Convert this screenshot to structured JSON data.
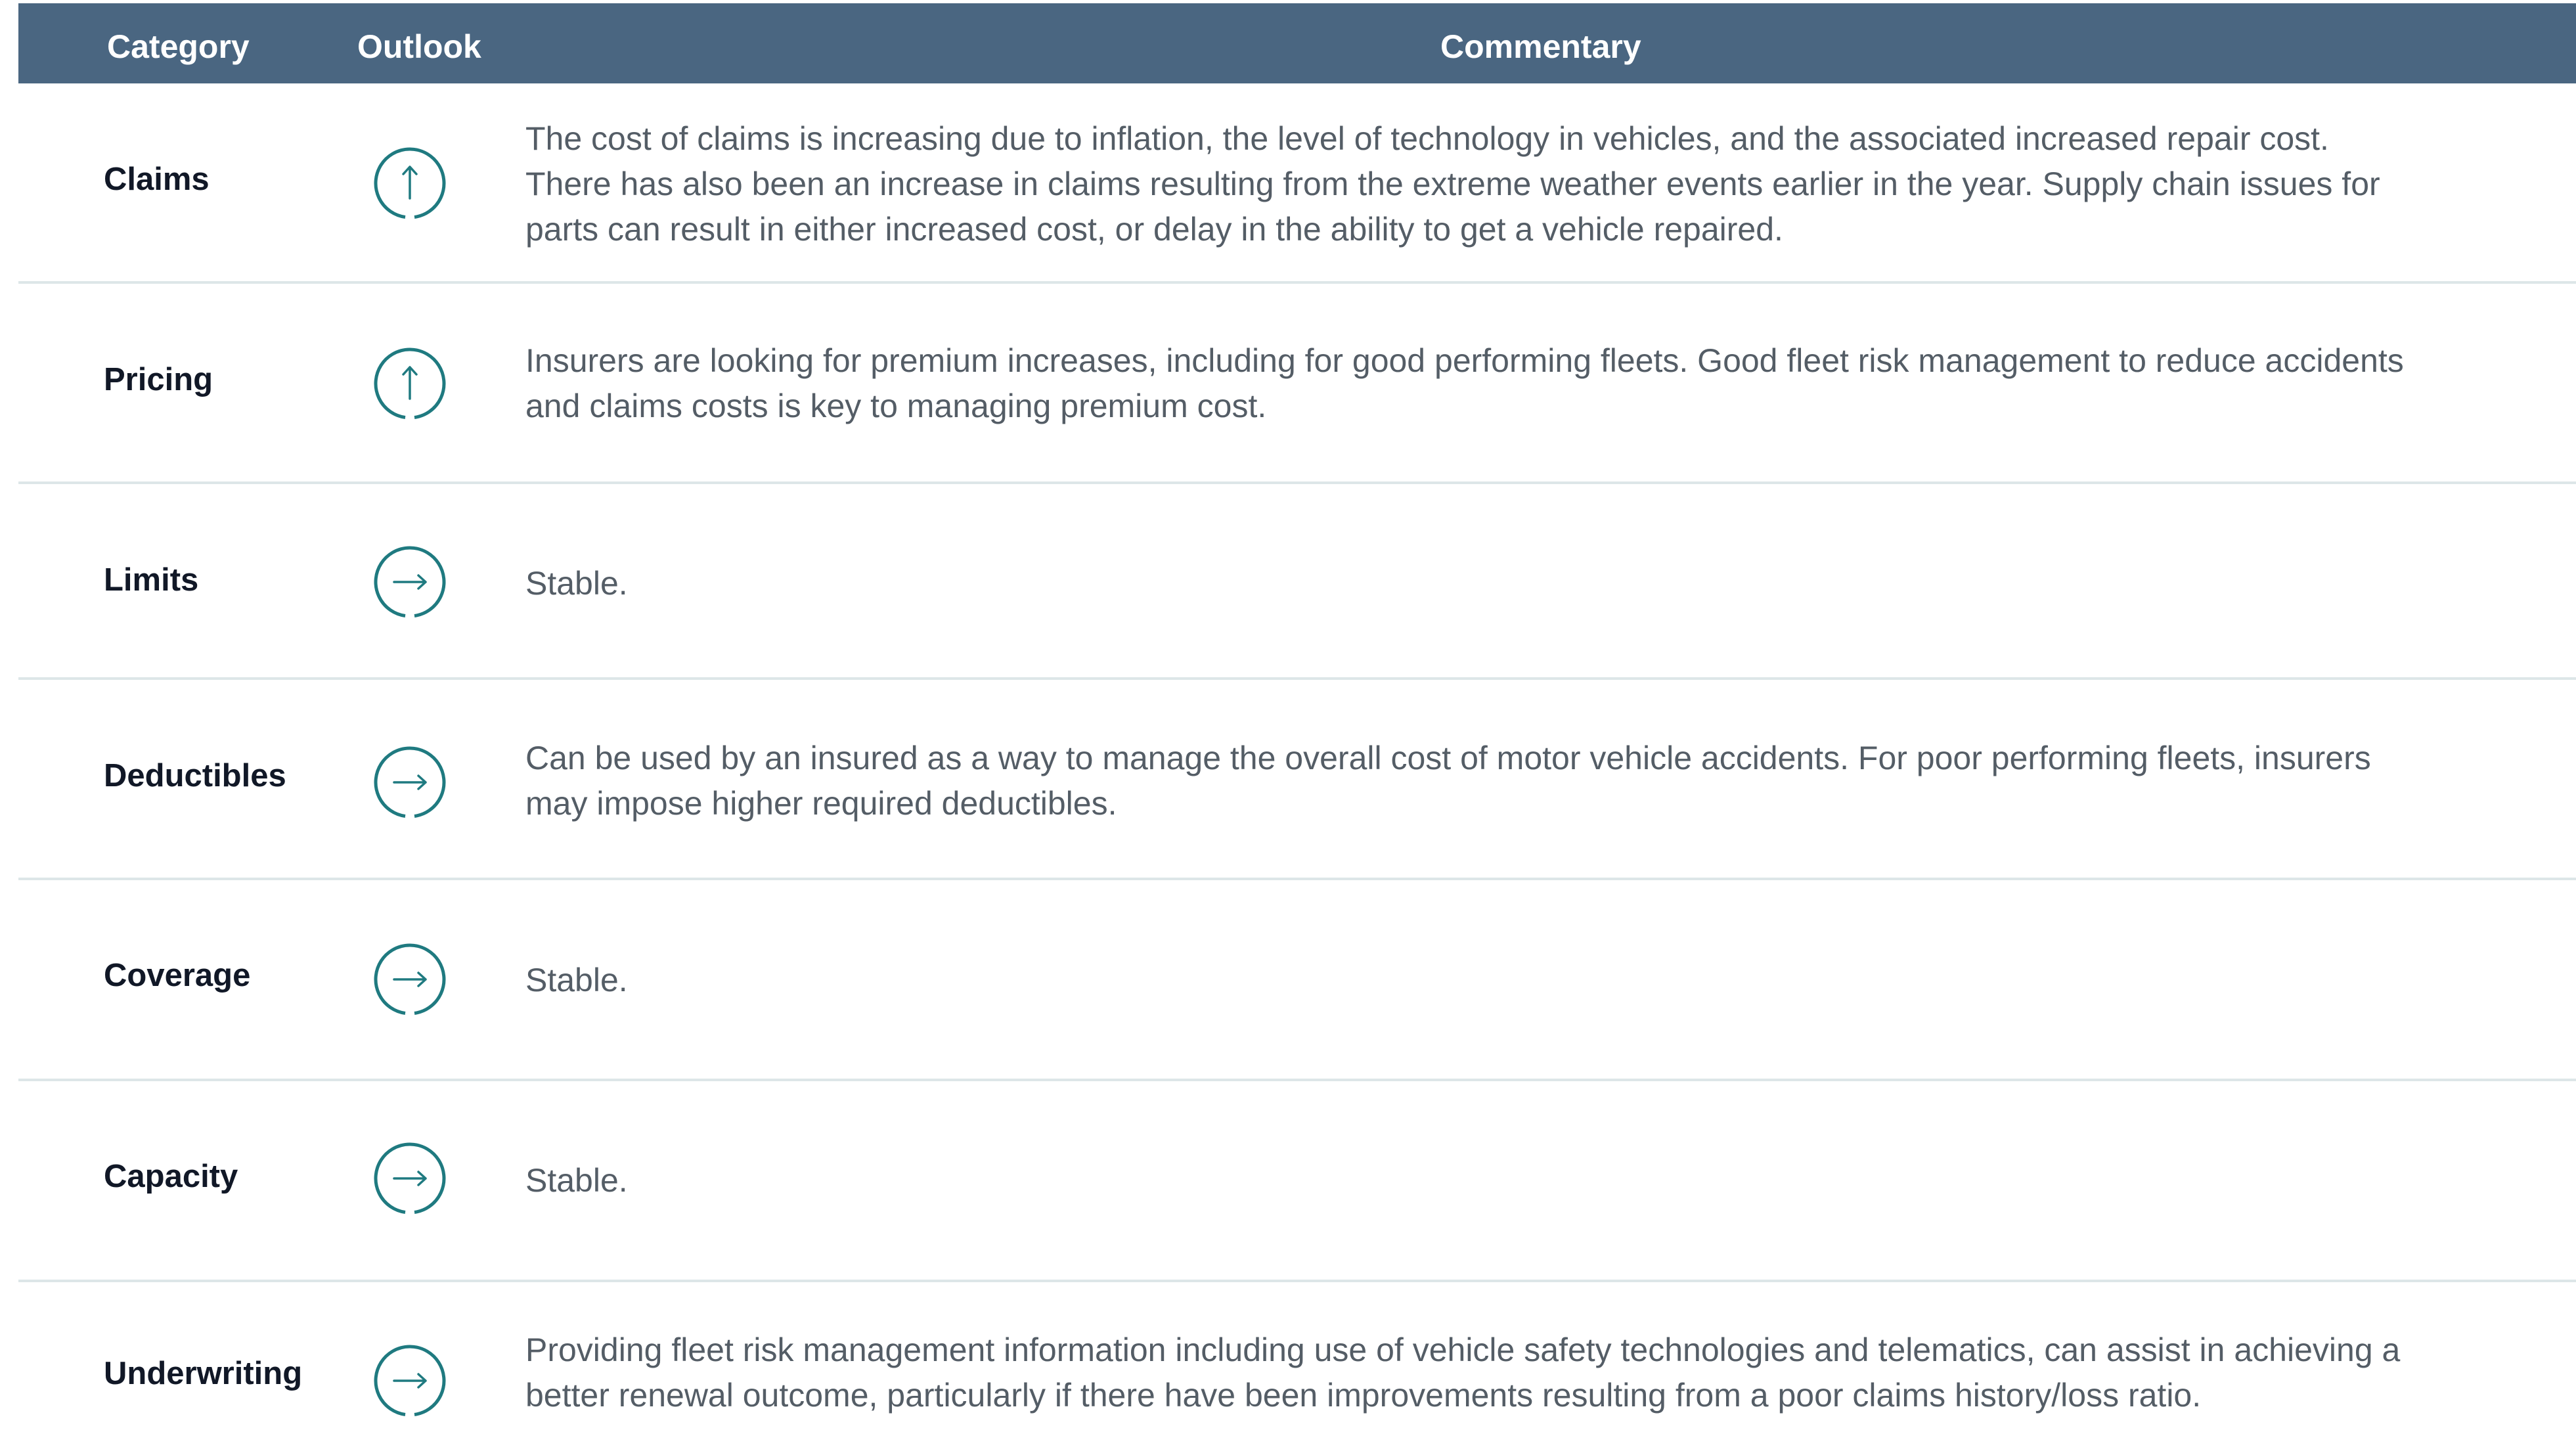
{
  "header": {
    "category_label": "Category",
    "outlook_label": "Outlook",
    "commentary_label": "Commentary"
  },
  "colors": {
    "header_bg": "#4a6681",
    "accent": "#1f7a80",
    "divider": "#dde6e8",
    "body_text": "#545d66",
    "category_text": "#111827"
  },
  "rows": [
    {
      "category": "Claims",
      "outlook": "up",
      "outlook_icon": "arrow-up-circle-icon",
      "commentary": "The cost of claims is increasing due to inflation, the level of technology in vehicles, and the associated increased repair cost.\nThere has also been an increase in claims resulting from the extreme weather events earlier in the year. Supply chain issues for\nparts can result in either increased cost, or delay in the ability to get a vehicle repaired."
    },
    {
      "category": "Pricing",
      "outlook": "up",
      "outlook_icon": "arrow-up-circle-icon",
      "commentary": "Insurers are looking for premium increases, including for good performing fleets. Good fleet risk management to reduce accidents\nand claims costs is key to managing premium cost."
    },
    {
      "category": "Limits",
      "outlook": "stable",
      "outlook_icon": "arrow-right-circle-icon",
      "commentary": "Stable."
    },
    {
      "category": "Deductibles",
      "outlook": "stable",
      "outlook_icon": "arrow-right-circle-icon",
      "commentary": "Can be used by an insured as a way to manage the overall cost of motor vehicle accidents. For poor performing fleets, insurers\nmay impose higher required deductibles."
    },
    {
      "category": "Coverage",
      "outlook": "stable",
      "outlook_icon": "arrow-right-circle-icon",
      "commentary": "Stable."
    },
    {
      "category": "Capacity",
      "outlook": "stable",
      "outlook_icon": "arrow-right-circle-icon",
      "commentary": "Stable."
    },
    {
      "category": "Underwriting",
      "outlook": "stable",
      "outlook_icon": "arrow-right-circle-icon",
      "commentary": "Providing fleet risk management information including use of vehicle safety technologies and telematics, can assist in achieving a\nbetter renewal outcome, particularly if there have been improvements resulting from a poor claims history/loss ratio."
    }
  ]
}
